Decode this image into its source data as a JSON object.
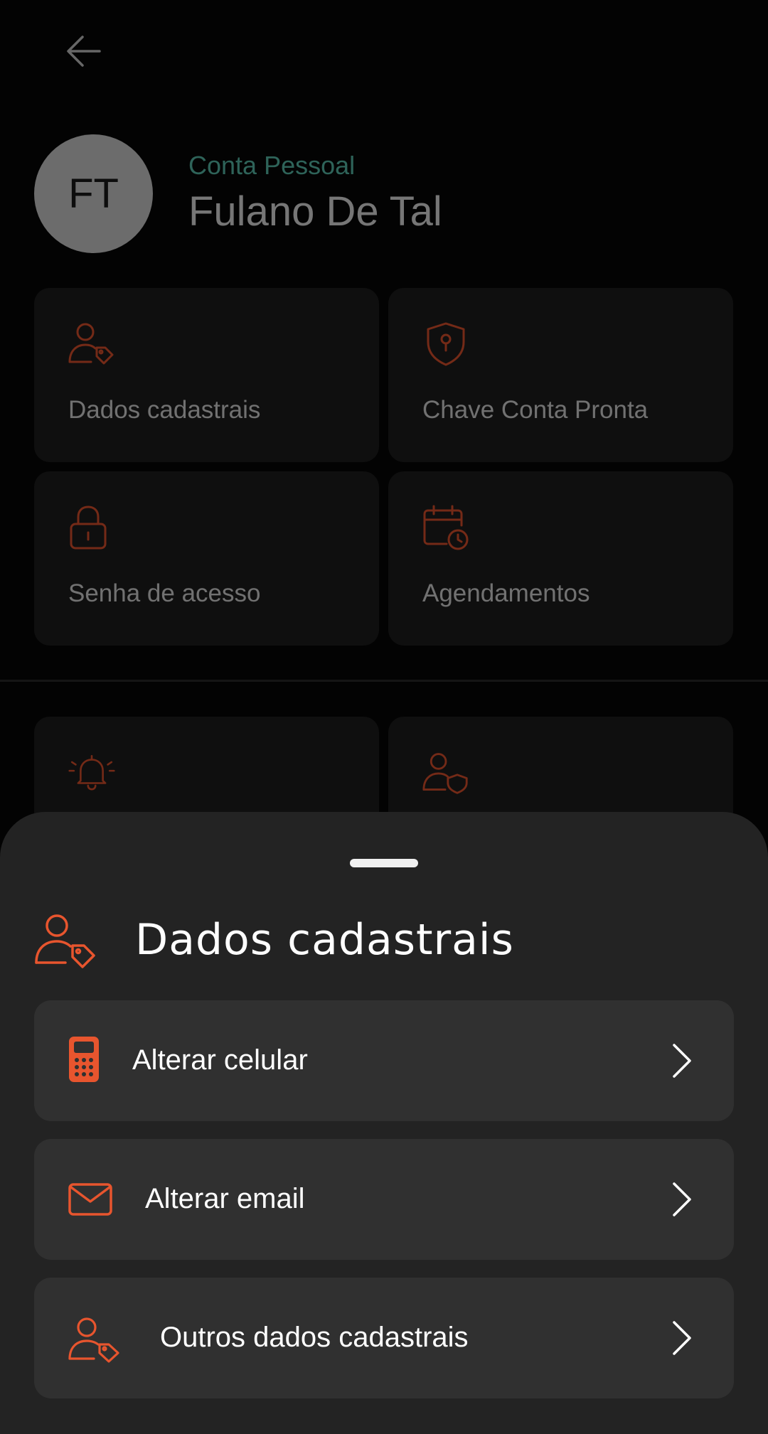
{
  "header": {
    "back_icon": "arrow-left-icon"
  },
  "profile": {
    "initials": "FT",
    "account_type": "Conta Pessoal",
    "name": "Fulano De Tal"
  },
  "tiles": [
    {
      "label": "Dados cadastrais",
      "icon": "user-tag-icon"
    },
    {
      "label": "Chave Conta Pronta",
      "icon": "shield-key-icon"
    },
    {
      "label": "Senha de acesso",
      "icon": "lock-icon"
    },
    {
      "label": "Agendamentos",
      "icon": "calendar-clock-icon"
    },
    {
      "label": "",
      "icon": "bell-ringing-icon"
    },
    {
      "label": "",
      "icon": "user-shield-icon"
    }
  ],
  "sheet": {
    "title": "Dados cadastrais",
    "icon": "user-tag-icon",
    "options": [
      {
        "label": "Alterar celular",
        "icon": "phone-icon"
      },
      {
        "label": "Alterar email",
        "icon": "mail-icon"
      },
      {
        "label": "Outros dados cadastrais",
        "icon": "user-tag-icon"
      }
    ]
  },
  "colors": {
    "accent": "#e8552e",
    "teal": "#5dc7b2",
    "background": "#070707",
    "sheet": "#232323",
    "card": "#303030"
  }
}
